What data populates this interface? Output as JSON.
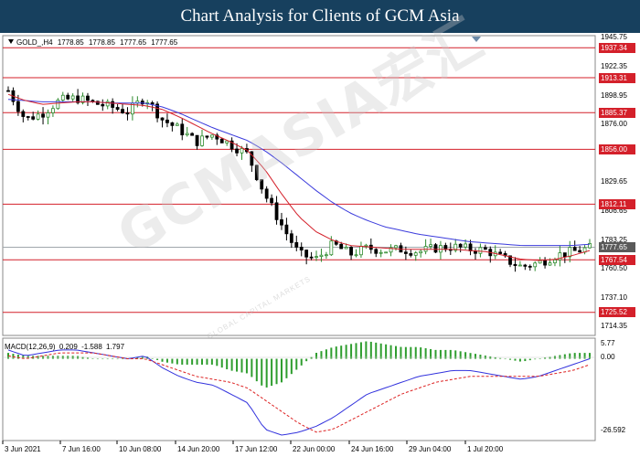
{
  "banner": {
    "title": "Chart Analysis for Clients of GCM Asia"
  },
  "symbol_info": {
    "symbol": "GOLD_,H4",
    "open": "1778.85",
    "high": "1778.85",
    "low": "1777.65",
    "close": "1777.65"
  },
  "watermark": {
    "brand": "GCMASIA",
    "chinese": "宏汇",
    "sub": "GLOBAL CAPITAL MARKETS"
  },
  "price_axis": {
    "min": 1707,
    "max": 1947,
    "ticks": [
      "1945.75",
      "1922.35",
      "1898.95",
      "1876.00",
      "1853.05",
      "1829.65",
      "1806.65",
      "1783.25",
      "1760.50",
      "1737.10",
      "1714.35"
    ],
    "current": "1777.65",
    "resistance_levels": [
      "1937.34",
      "1913.31",
      "1885.37",
      "1856.00",
      "1812.11",
      "1767.54",
      "1725.52"
    ]
  },
  "macd_info": {
    "label": "MACD(12,26,9)",
    "macd": "0.209",
    "signal": "-1.588",
    "hist": "1.797"
  },
  "macd_axis": {
    "top": "5.77",
    "zero": "0.00",
    "bottom": "-26.592"
  },
  "time_axis": [
    "3 Jun 2021",
    "7 Jun 16:00",
    "10 Jun 08:00",
    "14 Jun 20:00",
    "17 Jun 12:00",
    "22 Jun 00:00",
    "24 Jun 16:00",
    "29 Jun 04:00",
    "1 Jul 20:00"
  ],
  "colors": {
    "bull": "#2e8b2e",
    "bear": "#000000",
    "ma_blue": "#3b3bdc",
    "ma_red": "#d4202a",
    "level": "#d4202a",
    "current_line": "#a0a7ac",
    "macd_line": "#3333dd",
    "signal_line": "#dd2222",
    "hist": "#2e9d2e",
    "banner": "#17405e"
  },
  "chart_data": {
    "type": "candlestick",
    "title": "GOLD_,H4",
    "x": [
      "3 Jun 2021",
      "7 Jun 16:00",
      "10 Jun 08:00",
      "14 Jun 20:00",
      "17 Jun 12:00",
      "22 Jun 00:00",
      "24 Jun 16:00",
      "29 Jun 04:00",
      "1 Jul 20:00"
    ],
    "close_path": [
      1903,
      1880,
      1885,
      1895,
      1897,
      1893,
      1890,
      1886,
      1898,
      1880,
      1872,
      1862,
      1868,
      1860,
      1852,
      1820,
      1795,
      1772,
      1768,
      1780,
      1772,
      1777,
      1775,
      1776,
      1774,
      1777,
      1778,
      1776,
      1775,
      1768,
      1762,
      1765,
      1771,
      1774,
      1777
    ],
    "resistance_levels": [
      1937.34,
      1913.31,
      1885.37,
      1856.0,
      1812.11,
      1767.54,
      1725.52
    ],
    "ma_fast_path": [
      1900,
      1895,
      1892,
      1893,
      1894,
      1894,
      1893,
      1892,
      1891,
      1888,
      1882,
      1875,
      1868,
      1862,
      1855,
      1840,
      1820,
      1802,
      1790,
      1783,
      1779,
      1778,
      1777,
      1776,
      1776,
      1776,
      1776,
      1775,
      1774,
      1771,
      1768,
      1767,
      1768,
      1771,
      1775
    ],
    "ma_slow_path": [
      1896,
      1895,
      1894,
      1894,
      1894,
      1894,
      1893,
      1893,
      1893,
      1890,
      1885,
      1879,
      1873,
      1868,
      1863,
      1855,
      1845,
      1834,
      1823,
      1813,
      1805,
      1799,
      1794,
      1791,
      1788,
      1786,
      1784,
      1782,
      1781,
      1780,
      1779,
      1779,
      1779,
      1779,
      1780
    ],
    "current_price": 1777.65,
    "macd": {
      "range": [
        -26.592,
        5.77
      ],
      "macd_path": [
        3,
        1,
        2,
        3,
        3,
        2,
        1,
        0,
        1,
        -3,
        -6,
        -8,
        -9,
        -12,
        -15,
        -24,
        -26,
        -25,
        -23,
        -20,
        -16,
        -12,
        -10,
        -8,
        -6,
        -5,
        -4,
        -4,
        -5,
        -6,
        -7,
        -6,
        -4,
        -2,
        0
      ],
      "signal_path": [
        1,
        0,
        1,
        2,
        2,
        2,
        1,
        0,
        0,
        -2,
        -4,
        -6,
        -7,
        -8,
        -10,
        -14,
        -18,
        -22,
        -25,
        -24,
        -21,
        -18,
        -15,
        -12,
        -10,
        -8,
        -7,
        -6,
        -6,
        -6,
        -6,
        -6,
        -5,
        -4,
        -2
      ]
    }
  }
}
